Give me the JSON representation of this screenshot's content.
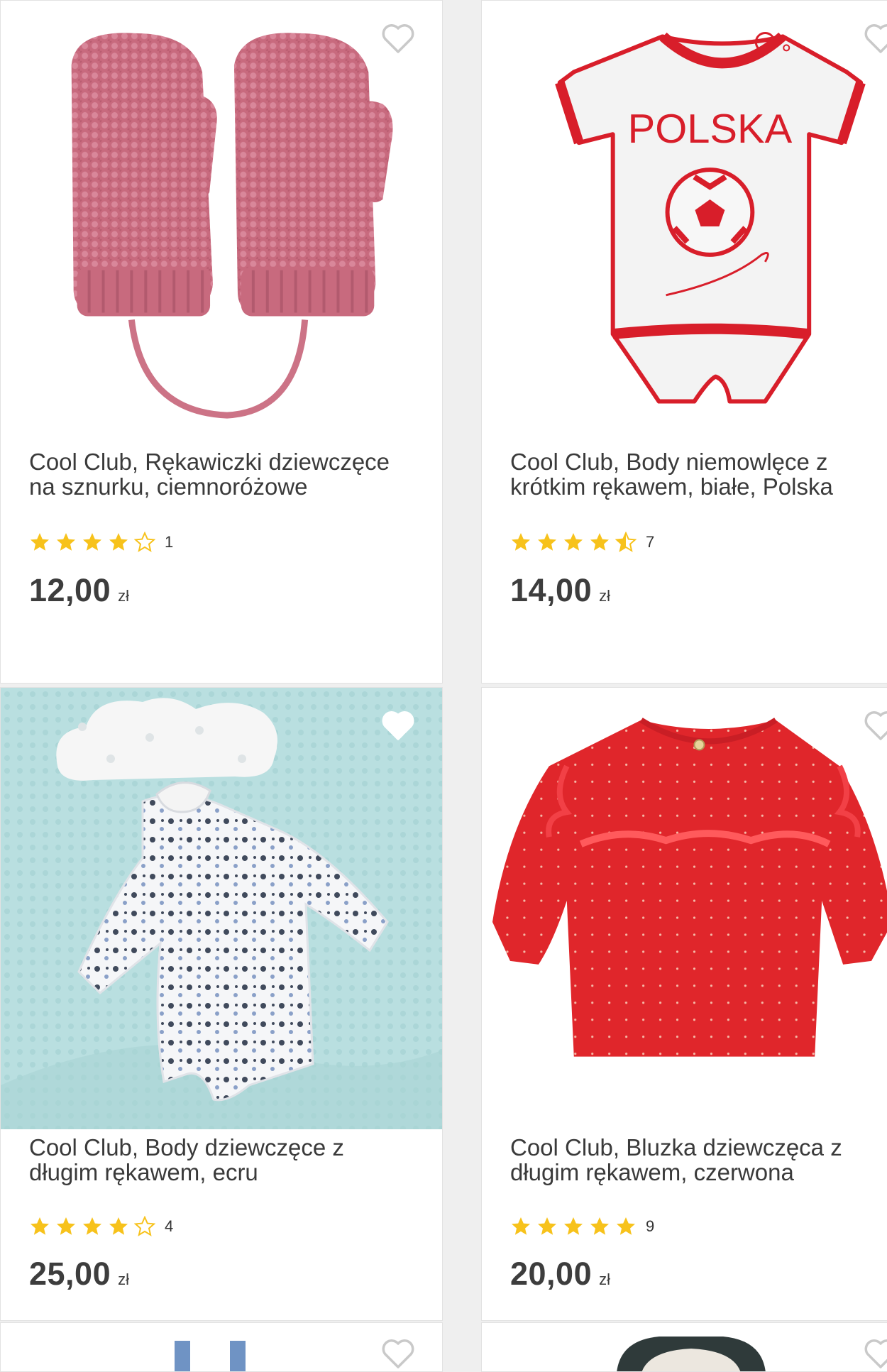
{
  "products": [
    {
      "title": "Cool Club, Rękawiczki dziewczęce na sznurku, ciemnoróżowe",
      "rating": 4,
      "rating_count": "1",
      "price": "12,00",
      "currency": "zł",
      "favorited": false
    },
    {
      "title": "Cool Club, Body niemowlęce z krótkim rękawem, białe, Polska",
      "rating": 4.5,
      "rating_count": "7",
      "price": "14,00",
      "currency": "zł",
      "favorited": false,
      "print_text": "POLSKA"
    },
    {
      "title": "Cool Club, Body dziewczęce z długim rękawem, ecru",
      "rating": 4,
      "rating_count": "4",
      "price": "25,00",
      "currency": "zł",
      "favorited": false
    },
    {
      "title": "Cool Club, Bluzka dziewczęca z długim rękawem, czerwona",
      "rating": 5,
      "rating_count": "9",
      "price": "20,00",
      "currency": "zł",
      "favorited": false
    }
  ],
  "colors": {
    "star": "#f7c21b",
    "heart_outline": "#c9c9c9"
  },
  "icons": {
    "favorite": "heart-outline-icon",
    "star_full": "star-filled-icon",
    "star_half": "star-half-icon",
    "star_empty": "star-outline-icon"
  }
}
